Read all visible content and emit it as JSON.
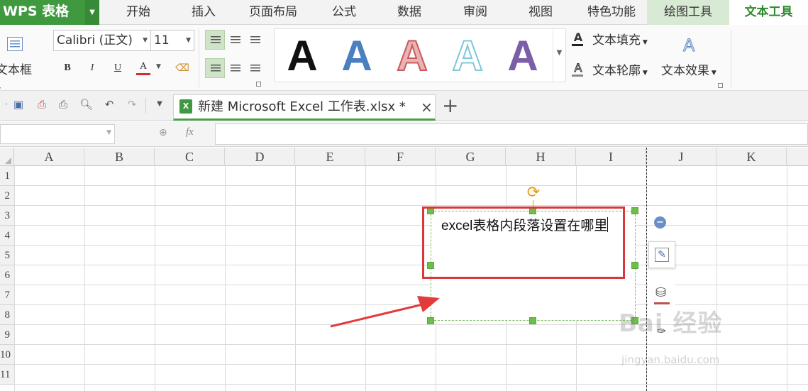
{
  "menubar": {
    "logo": "WPS 表格",
    "tabs": [
      "开始",
      "插入",
      "页面布局",
      "公式",
      "数据",
      "审阅",
      "视图",
      "特色功能",
      "绘图工具",
      "文本工具"
    ]
  },
  "ribbon": {
    "textbox_label": "文本框",
    "font_name": "Calibri (正文)",
    "font_size": "11",
    "bold": "B",
    "italic": "I",
    "underline": "U",
    "font_color_letter": "A",
    "wordart_letter": "A",
    "text_fill": "文本填充",
    "text_outline": "文本轮廓",
    "text_effect": "文本效果",
    "wordart_colors": [
      "#111111",
      "#4a7fc0",
      "#d98080",
      "#7fc8d8",
      "#7a5ea8"
    ]
  },
  "doc_tab": {
    "title": "新建 Microsoft Excel 工作表.xlsx *",
    "close": "×",
    "new_tab": "+"
  },
  "formulabar": {
    "fx": "fx"
  },
  "columns": [
    "A",
    "B",
    "C",
    "D",
    "E",
    "F",
    "G",
    "H",
    "I",
    "J",
    "K"
  ],
  "rows": [
    "1",
    "2",
    "3",
    "4",
    "5",
    "6",
    "7",
    "8",
    "9",
    "10",
    "11"
  ],
  "textbox": {
    "content": "excel表格内段落设置在哪里"
  },
  "watermark": {
    "brand": "Bai 经验",
    "url": "jingyan.baidu.com"
  },
  "colors": {
    "accent": "#3f9a3f",
    "highlight": "#d9383a",
    "handle": "#6cbf4b"
  }
}
